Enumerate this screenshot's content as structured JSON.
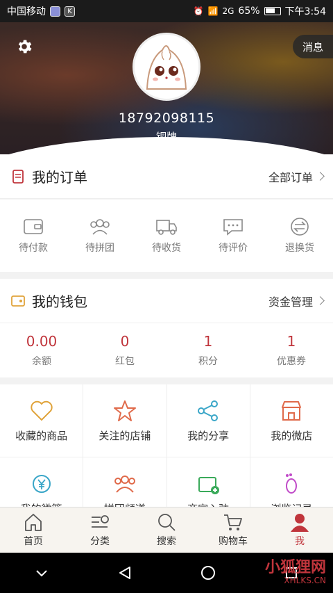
{
  "status_bar": {
    "carrier": "中国移动",
    "network": "2G",
    "battery": "65%",
    "time": "下午3:54",
    "k_badge": "K"
  },
  "header": {
    "message_label": "消息",
    "phone": "18792098115",
    "level": "铜牌"
  },
  "orders": {
    "title": "我的订单",
    "more": "全部订单",
    "items": [
      "待付款",
      "待拼团",
      "待收货",
      "待评价",
      "退换货"
    ]
  },
  "wallet": {
    "title": "我的钱包",
    "more": "资金管理",
    "items": [
      {
        "value": "0.00",
        "label": "余额"
      },
      {
        "value": "0",
        "label": "红包"
      },
      {
        "value": "1",
        "label": "积分"
      },
      {
        "value": "1",
        "label": "优惠券"
      }
    ]
  },
  "services": {
    "items": [
      "收藏的商品",
      "关注的店铺",
      "我的分享",
      "我的微店",
      "我的微篮",
      "拼团频道",
      "商家入驻",
      "浏览记录"
    ]
  },
  "tabbar": {
    "items": [
      "首页",
      "分类",
      "搜索",
      "购物车",
      "我"
    ],
    "active": "我"
  },
  "watermark": {
    "main": "小狐狸网",
    "sub": "XHLKS.CN"
  },
  "colors": {
    "accent": "#c0353c",
    "wallet_value": "#c0353c"
  }
}
